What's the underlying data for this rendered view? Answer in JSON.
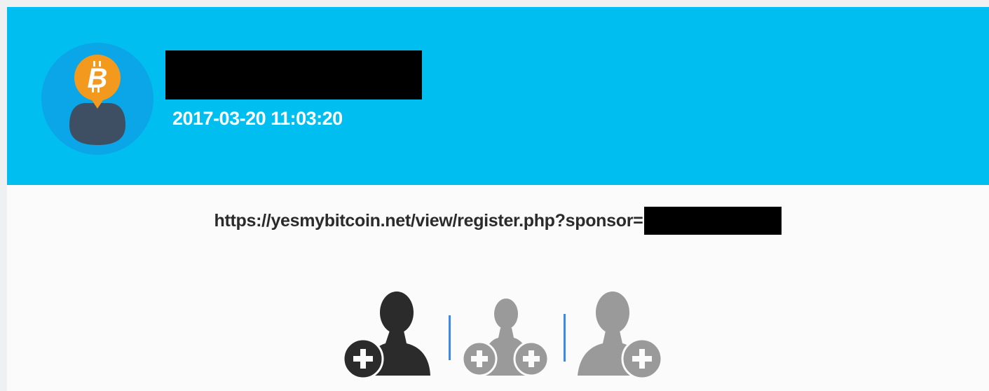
{
  "header": {
    "avatar_icon": "bitcoin-user-icon",
    "username": "",
    "timestamp": "2017-03-20 11:03:20",
    "background_color": "#00bff0"
  },
  "referral": {
    "url_prefix": "https://yesmybitcoin.net/view/register.php?sponsor=",
    "sponsor": ""
  },
  "actions": [
    {
      "icon": "add-user-left-icon",
      "state": "active",
      "color": "#2b2b2b"
    },
    {
      "icon": "add-user-both-icon",
      "state": "inactive",
      "color": "#9a9a9a"
    },
    {
      "icon": "add-user-right-icon",
      "state": "inactive",
      "color": "#9a9a9a"
    }
  ]
}
